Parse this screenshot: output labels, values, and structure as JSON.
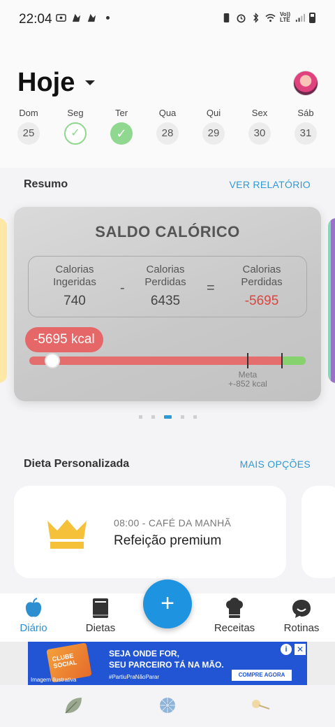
{
  "status_bar": {
    "time": "22:04",
    "volte": "Vo))\nLTE"
  },
  "header": {
    "title": "Hoje"
  },
  "week": [
    {
      "label": "Dom",
      "value": "25",
      "state": "default"
    },
    {
      "label": "Seg",
      "value": "✓",
      "state": "done"
    },
    {
      "label": "Ter",
      "value": "✓",
      "state": "today"
    },
    {
      "label": "Qua",
      "value": "28",
      "state": "default"
    },
    {
      "label": "Qui",
      "value": "29",
      "state": "default"
    },
    {
      "label": "Sex",
      "value": "30",
      "state": "default"
    },
    {
      "label": "Sáb",
      "value": "31",
      "state": "default"
    }
  ],
  "summary": {
    "title": "Resumo",
    "link": "VER RELATÓRIO",
    "card": {
      "title": "SALDO CALÓRICO",
      "ingested_label": "Calorias\nIngeridas",
      "ingested_value": "740",
      "minus": "-",
      "burned_label": "Calorias\nPerdidas",
      "burned_value": "6435",
      "equals": "=",
      "result_label": "Calorias\nPerdidas",
      "result_value": "-5695",
      "balance_label": "-5695 kcal",
      "goal_label": "Meta",
      "goal_value": "+-852 kcal"
    },
    "carousel_pages": 5,
    "carousel_active": 2
  },
  "diet": {
    "title": "Dieta Personalizada",
    "link": "MAIS OPÇÕES",
    "meal_time": "08:00 - CAFÉ DA MANHÃ",
    "meal_name": "Refeição premium",
    "icon": "crown-icon",
    "icon_color": "#f5c13b"
  },
  "bottom_nav": {
    "items": [
      {
        "label": "Diário",
        "icon": "apple-icon",
        "active": true
      },
      {
        "label": "Dietas",
        "icon": "book-icon",
        "active": false
      },
      {
        "label": "Receitas",
        "icon": "chef-hat-icon",
        "active": false
      },
      {
        "label": "Rotinas",
        "icon": "smile-chat-icon",
        "active": false
      }
    ],
    "fab": "+"
  },
  "ad": {
    "pack_text": "CLUBE\nSOCIAL",
    "line1": "SEJA ONDE FOR,",
    "line2": "SEU PARCEIRO TÁ NA MÃO.",
    "hashtag": "#PartiuPraNãoParar",
    "caption": "Imagem Ilustrativa",
    "cta": "COMPRE AGORA",
    "info": "i",
    "close": "✕"
  },
  "colors": {
    "accent": "#2d9ad6",
    "fab": "#1e93e0",
    "negative": "#d9463f",
    "done_green": "#90d890"
  }
}
